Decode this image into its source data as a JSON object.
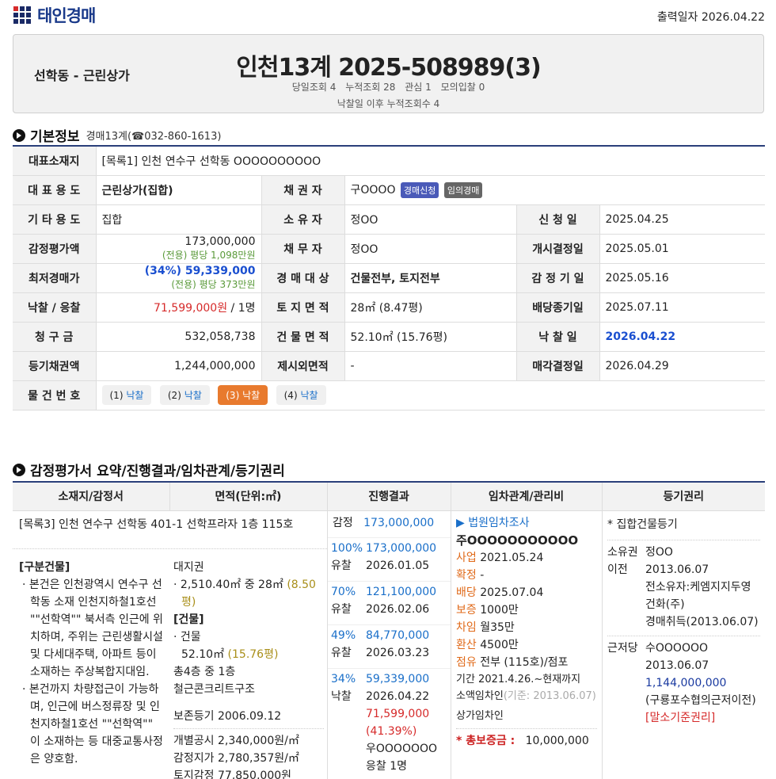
{
  "header": {
    "logo": "태인경매",
    "print_date": "출력일자 2026.04.22"
  },
  "case": {
    "location": "선학동 - 근린상가",
    "number": "인천13계 2025-508989(3)",
    "stats": [
      "당일조회 4",
      "누적조회 28",
      "관심 1",
      "모의입찰 0"
    ],
    "after": "낙찰일 이후 누적조회수 4"
  },
  "basic": {
    "title": "기본정보",
    "court": "경매13계(☎032-860-1613)",
    "rows": {
      "rep_loc_label": "대표소재지",
      "rep_loc": "[목록1] 인천 연수구 선학동 OOOOOOOOOO",
      "use_label": "대 표 용 도",
      "use": "근린상가(집합)",
      "creditor_label": "채 권 자",
      "creditor": "구OOOO",
      "badge1": "경매신청",
      "badge2": "임의경매",
      "other_use_label": "기 타 용 도",
      "other_use": "집합",
      "owner_label": "소 유 자",
      "owner": "정OO",
      "apply_label": "신 청 일",
      "apply": "2025.04.25",
      "appraisal_label": "감정평가액",
      "appraisal": "173,000,000",
      "appraisal_sub": "(전용) 평당 1,098만원",
      "debtor_label": "채 무 자",
      "debtor": "정OO",
      "start_label": "개시결정일",
      "start": "2025.05.01",
      "min_label": "최저경매가",
      "min": "(34%) 59,339,000",
      "min_sub": "(전용) 평당 373만원",
      "target_label": "경 매 대 상",
      "target": "건물전부, 토지전부",
      "appr_date_label": "감 정 기 일",
      "appr_date": "2025.05.16",
      "bid_label": "낙찰 / 응찰",
      "bid": "71,599,000원",
      "bid_count": " / 1명",
      "land_label": "토 지 면 적",
      "land": "28㎡ (8.47평)",
      "div_label": "배당종기일",
      "div": "2025.07.11",
      "claim_label": "청 구 금",
      "claim": "532,058,738",
      "bldg_label": "건 물 면 적",
      "bldg": "52.10㎡ (15.76평)",
      "sold_label": "낙 찰 일",
      "sold": "2026.04.22",
      "reg_label": "등기채권액",
      "reg": "1,244,000,000",
      "excl_label": "제시외면적",
      "excl": "-",
      "decide_label": "매각결정일",
      "decide": "2026.04.29",
      "item_label": "물 건 번 호"
    },
    "items": [
      {
        "n": "(1)",
        "s": "낙찰"
      },
      {
        "n": "(2)",
        "s": "낙찰"
      },
      {
        "n": "(3)",
        "s": "낙찰"
      },
      {
        "n": "(4)",
        "s": "낙찰"
      }
    ]
  },
  "summary": {
    "title": "감정평가서 요약/진행결과/임차관계/등기권리",
    "headers": [
      "소재지/감정서",
      "면적(단위:㎡)",
      "진행결과",
      "임차관계/관리비",
      "등기권리"
    ],
    "address": "[목록3] 인천 연수구 선학동 401-1 선학프라자 1층 115호",
    "desc_title": "[구분건물]",
    "desc1": "본건은 인천광역시 연수구 선학동 소재 인천지하철1호선 \"\"선학역\"\" 북서측 인근에 위치하며, 주위는 근린생활시설 및 다세대주택, 아파트 등이 소재하는 주상복합지대임.",
    "desc2": "본건까지 차량접근이 가능하며, 인근에 버스정류장 및 인천지하철1호선 \"\"선학역\"\" 이 소재하는 등 대중교통사정은 양호함.",
    "area": {
      "l1": "대지권",
      "l2": "2,510.40㎡ 중 28㎡",
      "l2g": "(8.50평)",
      "l3": "[건물]",
      "l4": "건물",
      "l5": "52.10㎡",
      "l5g": "(15.76평)",
      "l6": "총4층 중 1층",
      "l7": "철근콘크리트구조",
      "l8": "보존등기  2006.09.12",
      "l9": "개별공시 2,340,000원/㎡",
      "l10": "감정지가 2,780,357원/㎡",
      "l11": "토지감정 77,850,000원"
    },
    "progress": [
      {
        "a": "감정",
        "b": "173,000,000"
      },
      {
        "p": "100%",
        "v": "173,000,000",
        "s": "유찰",
        "d": "2026.01.05"
      },
      {
        "p": "70%",
        "v": "121,100,000",
        "s": "유찰",
        "d": "2026.02.06"
      },
      {
        "p": "49%",
        "v": "84,770,000",
        "s": "유찰",
        "d": "2026.03.23"
      },
      {
        "p": "34%",
        "v": "59,339,000",
        "s": "낙찰",
        "d": "2026.04.22",
        "bid": "71,599,000",
        "rate": "(41.39%)",
        "winner": "우OOOOOOO",
        "cnt": "응찰 1명"
      }
    ],
    "rent": {
      "link": "▶ 법원임차조사",
      "name": "주OOOOOOOOOOO",
      "r1k": "사업",
      "r1v": " 2021.05.24",
      "r2k": "확정",
      "r2v": " -",
      "r3k": "배당",
      "r3v": " 2025.07.04",
      "r4k": "보증",
      "r4v": " 1000만",
      "r5k": "차임",
      "r5v": " 월35만",
      "r6k": "환산",
      "r6v": " 4500만",
      "r7k": "점유",
      "r7v": " 전부 (115호)/점포",
      "r8": "기간 2021.4.26.~현재까지",
      "r9": "소액임차인",
      "r9m": "(기준: 2013.06.07)",
      "r10": "상가임차인",
      "total_label": "* 총보증금 :",
      "total": "10,000,000"
    },
    "reg": {
      "hdr": "* 집합건물등기",
      "own_k": "소유권",
      "own_v": "정OO",
      "tr_k": "이전",
      "tr_d": "2013.06.07",
      "tr_1": "전소유자:케엠지지두영건화(주)",
      "tr_2": "경매취득(2013.06.07)",
      "mort_k": "근저당",
      "mort_v": "수OOOOOO",
      "mort_d": "2013.06.07",
      "mort_amt": "1,144,000,000",
      "mort_1": "(구룡포수협의근저이전)",
      "mort_note": "[말소기준권리]"
    }
  }
}
